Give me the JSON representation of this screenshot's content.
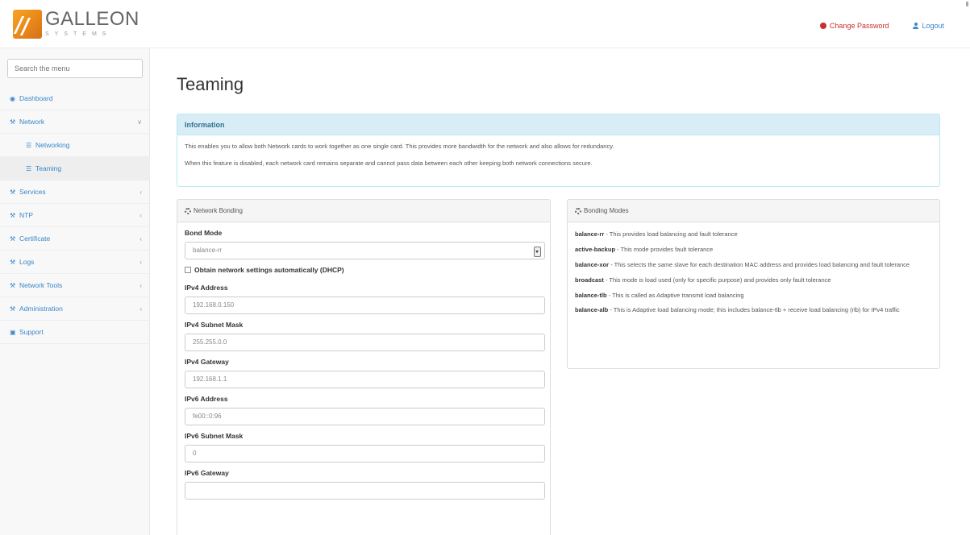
{
  "header": {
    "logo_name": "GALLEON",
    "logo_sub": "SYSTEMS",
    "change_password": "Change Password",
    "logout": "Logout"
  },
  "sidebar": {
    "search_placeholder": "Search the menu",
    "items": [
      {
        "label": "Dashboard",
        "icon": "dashboard-icon",
        "arrow": ""
      },
      {
        "label": "Network",
        "icon": "wrench-icon",
        "arrow": "∨"
      },
      {
        "label": "Networking",
        "icon": "list-icon",
        "arrow": "",
        "sub": true
      },
      {
        "label": "Teaming",
        "icon": "list-icon",
        "arrow": "",
        "sub": true,
        "active": true
      },
      {
        "label": "Services",
        "icon": "wrench-icon",
        "arrow": "‹"
      },
      {
        "label": "NTP",
        "icon": "wrench-icon",
        "arrow": "‹"
      },
      {
        "label": "Certificate",
        "icon": "wrench-icon",
        "arrow": "‹"
      },
      {
        "label": "Logs",
        "icon": "wrench-icon",
        "arrow": "‹"
      },
      {
        "label": "Network Tools",
        "icon": "wrench-icon",
        "arrow": "‹"
      },
      {
        "label": "Administration",
        "icon": "wrench-icon",
        "arrow": "‹"
      },
      {
        "label": "Support",
        "icon": "support-icon",
        "arrow": ""
      }
    ]
  },
  "main": {
    "title": "Teaming",
    "info": {
      "heading": "Information",
      "line1": "This enables you to allow both Network cards to work together as one single card. This provides more bandwidth for the network and also allows for redundancy.",
      "line2": "When this feature is disabled, each network card remains separate and cannot pass data between each other keeping both network connections secure."
    },
    "bonding": {
      "heading": "Network Bonding",
      "bond_mode_label": "Bond Mode",
      "bond_mode_value": "balance-rr",
      "dhcp_label": "Obtain network settings automatically (DHCP)",
      "fields": [
        {
          "label": "IPv4 Address",
          "value": "192.168.0.150"
        },
        {
          "label": "IPv4 Subnet Mask",
          "value": "255.255.0.0"
        },
        {
          "label": "IPv4 Gateway",
          "value": "192.168.1.1"
        },
        {
          "label": "IPv6 Address",
          "value": "fe00::0:96"
        },
        {
          "label": "IPv6 Subnet Mask",
          "value": "0"
        },
        {
          "label": "IPv6 Gateway",
          "value": ""
        }
      ]
    },
    "modes": {
      "heading": "Bonding Modes",
      "items": [
        {
          "name": "balance-rr",
          "desc": " - This provides load balancing and fault tolerance"
        },
        {
          "name": "active-backup",
          "desc": " - This mode provides fault tolerance"
        },
        {
          "name": "balance-xor",
          "desc": " - This selects the same slave for each destination MAC address and provides load balancing and fault tolerance"
        },
        {
          "name": "broadcast",
          "desc": " - This mode is load used (only for specific purpose) and provides only fault tolerance"
        },
        {
          "name": "balance-tlb",
          "desc": " - This is called as Adaptive transmit load balancing"
        },
        {
          "name": "balance-alb",
          "desc": " - This is Adaptive load balancing mode; this includes balance-tlb + receive load balancing (rlb) for IPv4 traffic"
        }
      ]
    }
  }
}
